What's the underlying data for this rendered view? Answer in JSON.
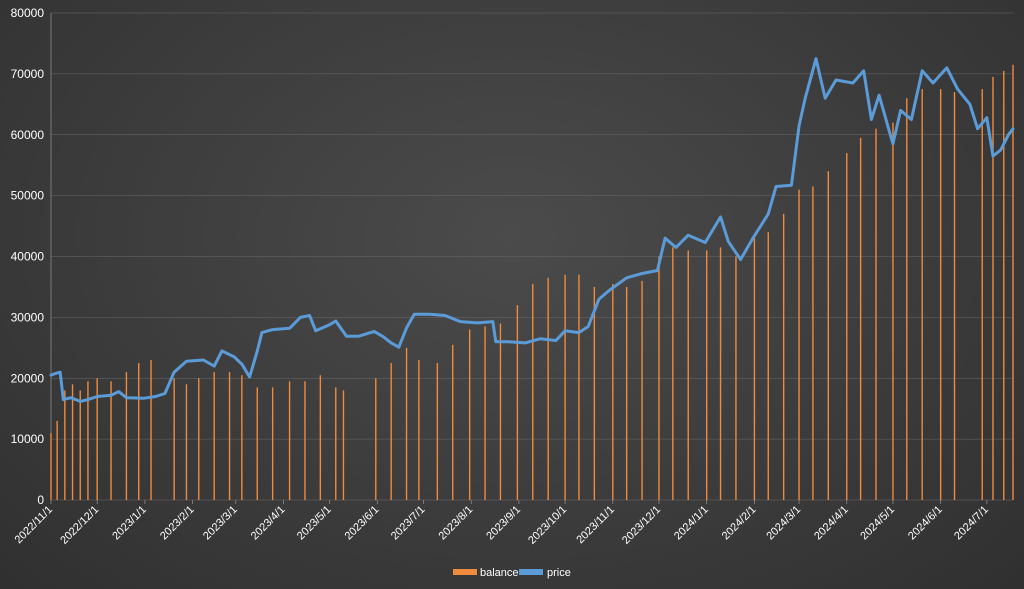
{
  "chart_data": {
    "type": "bar+line",
    "title": "",
    "xlabel": "",
    "ylabel": "",
    "ylim": [
      0,
      80000
    ],
    "yticks": [
      0,
      10000,
      20000,
      30000,
      40000,
      50000,
      60000,
      70000,
      80000
    ],
    "xticks": [
      "2022/11/1",
      "2022/12/1",
      "2023/1/1",
      "2023/2/1",
      "2023/3/1",
      "2023/4/1",
      "2023/5/1",
      "2023/6/1",
      "2023/7/1",
      "2023/8/1",
      "2023/9/1",
      "2023/10/1",
      "2023/11/1",
      "2023/12/1",
      "2024/1/1",
      "2024/2/1",
      "2024/3/1",
      "2024/4/1",
      "2024/5/1",
      "2024/6/1",
      "2024/7/1"
    ],
    "xrange": [
      "2022/11/1",
      "2024/7/18"
    ],
    "grid": true,
    "legend": {
      "placement": "bottom-center",
      "items": [
        {
          "name": "balance",
          "color": "#f08a3c",
          "kind": "bar"
        },
        {
          "name": "price",
          "color": "#5b9bd8",
          "kind": "line"
        }
      ]
    },
    "series": [
      {
        "name": "balance",
        "kind": "bar",
        "color": "#f08a3c",
        "points": [
          [
            "2022/11/1",
            11000
          ],
          [
            "2022/11/5",
            13000
          ],
          [
            "2022/11/10",
            18000
          ],
          [
            "2022/11/15",
            19000
          ],
          [
            "2022/11/20",
            18000
          ],
          [
            "2022/11/25",
            19500
          ],
          [
            "2022/12/1",
            20000
          ],
          [
            "2022/12/10",
            19500
          ],
          [
            "2022/12/20",
            21000
          ],
          [
            "2022/12/28",
            22500
          ],
          [
            "2023/1/5",
            23000
          ],
          [
            "2023/1/15",
            0
          ],
          [
            "2023/1/20",
            20000
          ],
          [
            "2023/1/28",
            19000
          ],
          [
            "2023/2/5",
            20000
          ],
          [
            "2023/2/15",
            21000
          ],
          [
            "2023/2/25",
            21000
          ],
          [
            "2023/3/5",
            20500
          ],
          [
            "2023/3/15",
            18500
          ],
          [
            "2023/3/25",
            18500
          ],
          [
            "2023/4/5",
            19500
          ],
          [
            "2023/4/15",
            19500
          ],
          [
            "2023/4/25",
            20500
          ],
          [
            "2023/5/5",
            18500
          ],
          [
            "2023/5/10",
            18000
          ],
          [
            "2023/5/15",
            0
          ],
          [
            "2023/5/25",
            0
          ],
          [
            "2023/5/31",
            20000
          ],
          [
            "2023/6/10",
            22500
          ],
          [
            "2023/6/20",
            25000
          ],
          [
            "2023/6/28",
            23000
          ],
          [
            "2023/7/10",
            22500
          ],
          [
            "2023/7/20",
            25500
          ],
          [
            "2023/7/31",
            28000
          ],
          [
            "2023/8/10",
            28500
          ],
          [
            "2023/8/20",
            29000
          ],
          [
            "2023/8/31",
            32000
          ],
          [
            "2023/9/10",
            35500
          ],
          [
            "2023/9/20",
            36500
          ],
          [
            "2023/10/1",
            37000
          ],
          [
            "2023/10/10",
            37000
          ],
          [
            "2023/10/20",
            35000
          ],
          [
            "2023/11/1",
            35500
          ],
          [
            "2023/11/10",
            35000
          ],
          [
            "2023/11/20",
            36000
          ],
          [
            "2023/12/1",
            40000
          ],
          [
            "2023/12/10",
            41500
          ],
          [
            "2023/12/20",
            41000
          ],
          [
            "2024/1/1",
            41000
          ],
          [
            "2024/1/10",
            41500
          ],
          [
            "2024/1/20",
            40000
          ],
          [
            "2024/2/1",
            43000
          ],
          [
            "2024/2/10",
            44000
          ],
          [
            "2024/2/20",
            47000
          ],
          [
            "2024/3/1",
            51000
          ],
          [
            "2024/3/10",
            51500
          ],
          [
            "2024/3/20",
            54000
          ],
          [
            "2024/4/1",
            57000
          ],
          [
            "2024/4/10",
            59500
          ],
          [
            "2024/4/20",
            61000
          ],
          [
            "2024/5/1",
            62000
          ],
          [
            "2024/5/10",
            66000
          ],
          [
            "2024/5/20",
            67500
          ],
          [
            "2024/6/1",
            67500
          ],
          [
            "2024/6/10",
            67000
          ],
          [
            "2024/6/20",
            0
          ],
          [
            "2024/6/28",
            67500
          ],
          [
            "2024/7/5",
            69500
          ],
          [
            "2024/7/12",
            70500
          ],
          [
            "2024/7/18",
            71500
          ]
        ]
      },
      {
        "name": "price",
        "kind": "line",
        "color": "#5b9bd8",
        "points": [
          [
            "2022/11/1",
            20500
          ],
          [
            "2022/11/4",
            20800
          ],
          [
            "2022/11/7",
            21000
          ],
          [
            "2022/11/9",
            16500
          ],
          [
            "2022/11/14",
            16800
          ],
          [
            "2022/11/20",
            16200
          ],
          [
            "2022/11/25",
            16500
          ],
          [
            "2022/12/1",
            17000
          ],
          [
            "2022/12/10",
            17200
          ],
          [
            "2022/12/15",
            17800
          ],
          [
            "2022/12/20",
            16800
          ],
          [
            "2022/12/31",
            16700
          ],
          [
            "2023/1/8",
            17000
          ],
          [
            "2023/1/14",
            17500
          ],
          [
            "2023/1/20",
            21000
          ],
          [
            "2023/1/28",
            22800
          ],
          [
            "2023/2/8",
            23000
          ],
          [
            "2023/2/15",
            22000
          ],
          [
            "2023/2/20",
            24500
          ],
          [
            "2023/2/28",
            23500
          ],
          [
            "2023/3/5",
            22300
          ],
          [
            "2023/3/10",
            20200
          ],
          [
            "2023/3/15",
            24500
          ],
          [
            "2023/3/18",
            27500
          ],
          [
            "2023/3/25",
            28000
          ],
          [
            "2023/4/5",
            28200
          ],
          [
            "2023/4/12",
            30000
          ],
          [
            "2023/4/18",
            30300
          ],
          [
            "2023/4/22",
            27800
          ],
          [
            "2023/5/1",
            28800
          ],
          [
            "2023/5/5",
            29400
          ],
          [
            "2023/5/12",
            26900
          ],
          [
            "2023/5/20",
            26900
          ],
          [
            "2023/5/30",
            27700
          ],
          [
            "2023/6/5",
            26800
          ],
          [
            "2023/6/10",
            25800
          ],
          [
            "2023/6/15",
            25100
          ],
          [
            "2023/6/20",
            28300
          ],
          [
            "2023/6/25",
            30500
          ],
          [
            "2023/7/5",
            30500
          ],
          [
            "2023/7/15",
            30300
          ],
          [
            "2023/7/25",
            29300
          ],
          [
            "2023/8/5",
            29100
          ],
          [
            "2023/8/15",
            29300
          ],
          [
            "2023/8/17",
            26000
          ],
          [
            "2023/8/25",
            26000
          ],
          [
            "2023/9/5",
            25800
          ],
          [
            "2023/9/15",
            26500
          ],
          [
            "2023/9/25",
            26200
          ],
          [
            "2023/10/1",
            27800
          ],
          [
            "2023/10/10",
            27500
          ],
          [
            "2023/10/16",
            28500
          ],
          [
            "2023/10/23",
            33000
          ],
          [
            "2023/10/30",
            34500
          ],
          [
            "2023/11/10",
            36500
          ],
          [
            "2023/11/20",
            37200
          ],
          [
            "2023/11/30",
            37700
          ],
          [
            "2023/12/5",
            43000
          ],
          [
            "2023/12/12",
            41500
          ],
          [
            "2023/12/20",
            43500
          ],
          [
            "2023/12/31",
            42300
          ],
          [
            "2024/1/10",
            46500
          ],
          [
            "2024/1/15",
            42500
          ],
          [
            "2024/1/23",
            39500
          ],
          [
            "2024/1/31",
            43000
          ],
          [
            "2024/2/10",
            47000
          ],
          [
            "2024/2/15",
            51500
          ],
          [
            "2024/2/25",
            51700
          ],
          [
            "2024/3/1",
            61500
          ],
          [
            "2024/3/5",
            66000
          ],
          [
            "2024/3/12",
            72500
          ],
          [
            "2024/3/18",
            66000
          ],
          [
            "2024/3/25",
            69000
          ],
          [
            "2024/4/5",
            68500
          ],
          [
            "2024/4/12",
            70500
          ],
          [
            "2024/4/17",
            62500
          ],
          [
            "2024/4/22",
            66500
          ],
          [
            "2024/5/1",
            58500
          ],
          [
            "2024/5/6",
            64000
          ],
          [
            "2024/5/13",
            62500
          ],
          [
            "2024/5/20",
            70500
          ],
          [
            "2024/5/27",
            68500
          ],
          [
            "2024/6/5",
            71000
          ],
          [
            "2024/6/12",
            67500
          ],
          [
            "2024/6/20",
            65000
          ],
          [
            "2024/6/25",
            61000
          ],
          [
            "2024/7/1",
            62800
          ],
          [
            "2024/7/5",
            56500
          ],
          [
            "2024/7/10",
            57500
          ],
          [
            "2024/7/15",
            60000
          ],
          [
            "2024/7/18",
            61000
          ]
        ]
      }
    ]
  }
}
